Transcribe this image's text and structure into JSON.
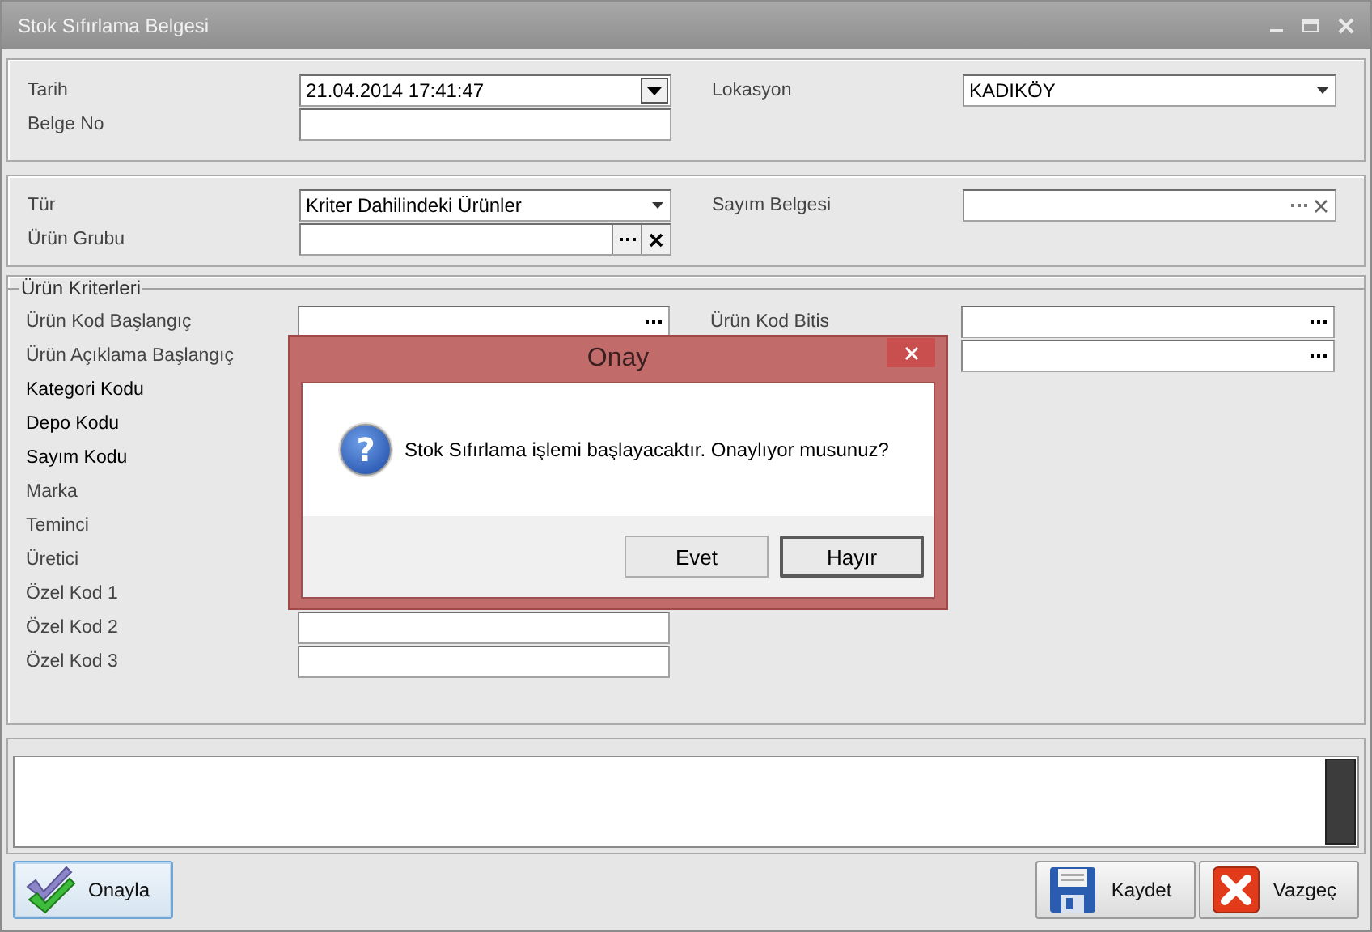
{
  "window": {
    "title": "Stok Sıfırlama Belgesi"
  },
  "header_panel": {
    "left": [
      {
        "label": "Tarih",
        "required": false,
        "field": {
          "kind": "date",
          "value": "21.04.2014 17:41:47"
        }
      },
      {
        "label": "Belge No",
        "required": false,
        "field": {
          "kind": "text"
        }
      }
    ],
    "right": [
      {
        "label": "Lokasyon",
        "required": false,
        "field": {
          "kind": "combo",
          "value": "KADIKÖY"
        }
      }
    ]
  },
  "type_panel": {
    "left": [
      {
        "label": "Tür",
        "required": false,
        "field": {
          "kind": "combo",
          "value": "Kriter Dahilindeki Ürünler"
        }
      },
      {
        "label": "Ürün Grubu",
        "required": false,
        "field": {
          "kind": "lookup_box"
        }
      }
    ],
    "right": [
      {
        "label": "Sayım Belgesi",
        "required": false,
        "field": {
          "kind": "lookup_clear"
        }
      }
    ]
  },
  "criteria_panel": {
    "title": "Ürün Kriterleri",
    "left": [
      {
        "label": "Ürün Kod Başlangıç",
        "required": false,
        "field": {
          "kind": "lookup"
        }
      },
      {
        "label": "Ürün Açıklama Başlangıç",
        "required": false
      },
      {
        "label": "Kategori Kodu",
        "required": true
      },
      {
        "label": "Depo Kodu",
        "required": true
      },
      {
        "label": "Sayım Kodu",
        "required": true
      },
      {
        "label": "Marka",
        "required": false
      },
      {
        "label": "Teminci",
        "required": false
      },
      {
        "label": "Üretici",
        "required": false
      },
      {
        "label": "Özel Kod 1",
        "required": false
      },
      {
        "label": "Özel Kod 2",
        "required": false,
        "field": {
          "kind": "text"
        }
      },
      {
        "label": "Özel Kod 3",
        "required": false,
        "field": {
          "kind": "text"
        }
      }
    ],
    "right": [
      {
        "label": "Ürün Kod Bitis",
        "required": false,
        "field": {
          "kind": "lookup"
        }
      },
      {
        "field": {
          "kind": "lookup"
        }
      }
    ]
  },
  "buttons_left": [
    {
      "label": "Onayla",
      "kind": "check",
      "focused": true
    }
  ],
  "buttons_right": [
    {
      "label": "Kaydet",
      "kind": "save",
      "focused": false
    },
    {
      "label": "Vazgeç",
      "kind": "cancel",
      "focused": false
    }
  ],
  "dialog": {
    "title": "Onay",
    "icon_glyph": "?",
    "message": "Stok Sıfırlama işlemi başlayacaktır. Onaylıyor musunuz?",
    "buttons": [
      {
        "label": "Evet",
        "default": false
      },
      {
        "label": "Hayır",
        "default": true
      }
    ]
  }
}
